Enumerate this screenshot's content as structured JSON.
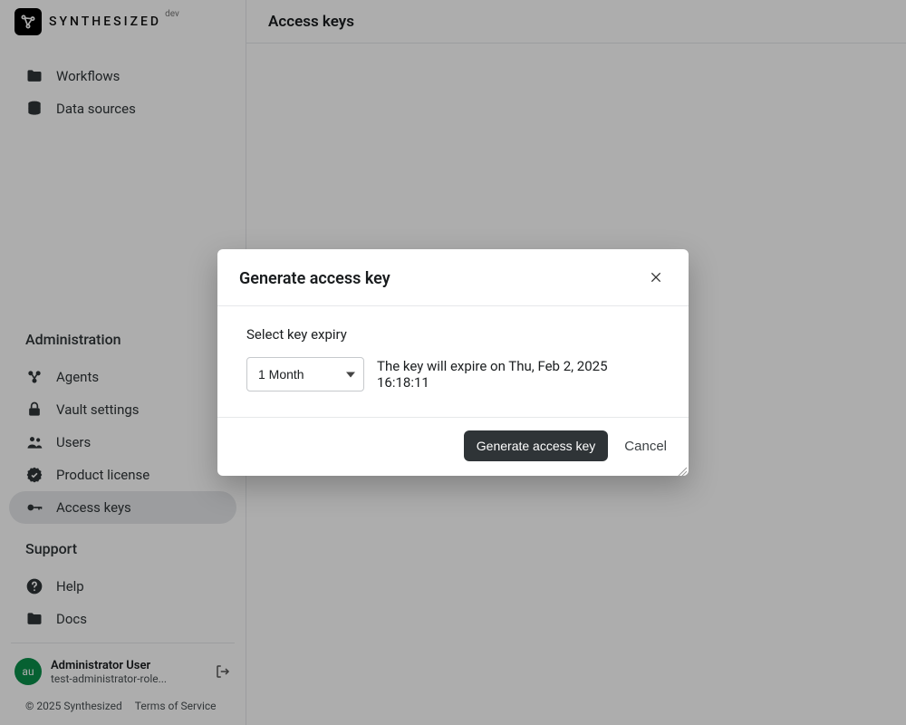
{
  "brand": {
    "name": "SYNTHESIZED",
    "badge": "dev"
  },
  "sidebar": {
    "top": [
      {
        "label": "Workflows",
        "icon": "folder-icon"
      },
      {
        "label": "Data sources",
        "icon": "database-icon"
      }
    ],
    "admin_title": "Administration",
    "admin": [
      {
        "label": "Agents",
        "icon": "agents-icon"
      },
      {
        "label": "Vault settings",
        "icon": "lock-icon"
      },
      {
        "label": "Users",
        "icon": "users-icon"
      },
      {
        "label": "Product license",
        "icon": "verified-icon"
      },
      {
        "label": "Access keys",
        "icon": "key-icon"
      }
    ],
    "support_title": "Support",
    "support": [
      {
        "label": "Help",
        "icon": "help-icon"
      },
      {
        "label": "Docs",
        "icon": "folder-icon"
      }
    ]
  },
  "user": {
    "initials": "au",
    "name": "Administrator User",
    "email": "test-administrator-role..."
  },
  "footer": {
    "copyright": "© 2025 Synthesized",
    "tos": "Terms of Service"
  },
  "page": {
    "title": "Access keys"
  },
  "modal": {
    "title": "Generate access key",
    "field_label": "Select key expiry",
    "select_value": "1 Month",
    "expiry_text": "The key will expire on Thu, Feb 2, 2025 16:18:11",
    "primary": "Generate access key",
    "cancel": "Cancel"
  }
}
